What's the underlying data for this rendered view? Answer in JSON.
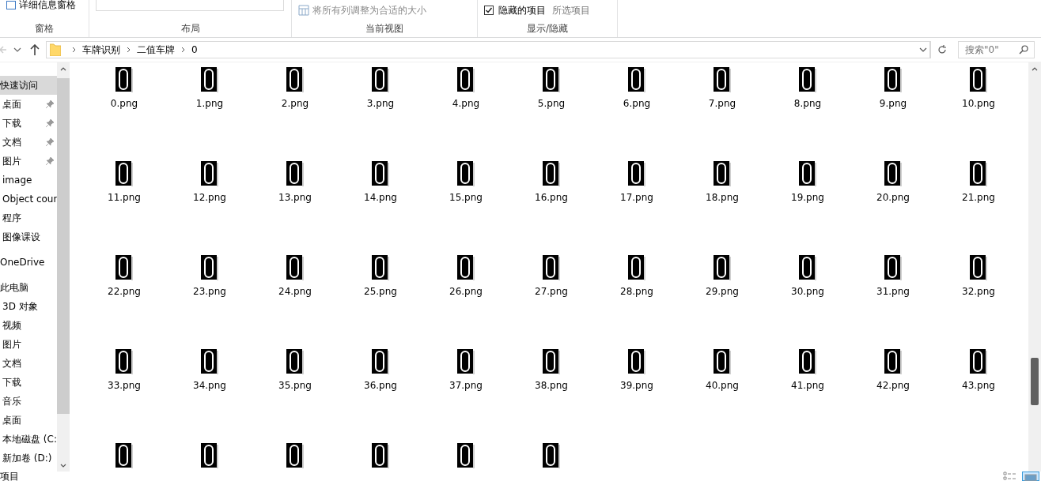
{
  "ribbon": {
    "groups": [
      {
        "label": "窗格",
        "items": [
          {
            "kind": "pane-button",
            "label": "详细信息窗格"
          }
        ]
      },
      {
        "label": "布局",
        "items": [
          {
            "kind": "layout-list"
          }
        ]
      },
      {
        "label": "当前视图",
        "items": [
          {
            "kind": "fit-columns",
            "label": "将所有列调整为合适的大小"
          }
        ]
      },
      {
        "label": "显示/隐藏",
        "items": [
          {
            "kind": "checkbox",
            "label": "隐藏的项目",
            "checked": true
          },
          {
            "kind": "text-button",
            "label": "所选项目"
          }
        ]
      }
    ]
  },
  "address": {
    "crumbs": [
      "车牌识别",
      "二值车牌",
      "0"
    ],
    "search_placeholder": "搜索\"0\""
  },
  "sidebar": {
    "items": [
      {
        "kind": "header",
        "label": "快速访问",
        "selected": true
      },
      {
        "kind": "pinned",
        "label": "桌面",
        "selected": false
      },
      {
        "kind": "pinned",
        "label": "下载",
        "selected": false
      },
      {
        "kind": "pinned",
        "label": "文档",
        "selected": false
      },
      {
        "kind": "pinned",
        "label": "图片",
        "selected": false
      },
      {
        "kind": "item",
        "label": "image",
        "selected": false
      },
      {
        "kind": "item",
        "label": "Object cour",
        "selected": false
      },
      {
        "kind": "item",
        "label": "程序",
        "selected": false
      },
      {
        "kind": "item",
        "label": "图像课设",
        "selected": false
      },
      {
        "kind": "header",
        "label": "OneDrive",
        "selected": false
      },
      {
        "kind": "header",
        "label": "此电脑",
        "selected": false
      },
      {
        "kind": "item",
        "label": "3D 对象",
        "selected": false
      },
      {
        "kind": "item",
        "label": "视频",
        "selected": false
      },
      {
        "kind": "item",
        "label": "图片",
        "selected": false
      },
      {
        "kind": "item",
        "label": "文档",
        "selected": false
      },
      {
        "kind": "item",
        "label": "下载",
        "selected": false
      },
      {
        "kind": "item",
        "label": "音乐",
        "selected": false
      },
      {
        "kind": "item",
        "label": "桌面",
        "selected": false
      },
      {
        "kind": "item",
        "label": "本地磁盘 (C:",
        "selected": false
      },
      {
        "kind": "item",
        "label": "新加卷 (D:)",
        "selected": false
      }
    ]
  },
  "files": [
    {
      "kind": "file",
      "label": "0.png"
    },
    {
      "kind": "file",
      "label": "1.png"
    },
    {
      "kind": "file",
      "label": "2.png"
    },
    {
      "kind": "file",
      "label": "3.png"
    },
    {
      "kind": "file",
      "label": "4.png"
    },
    {
      "kind": "file",
      "label": "5.png"
    },
    {
      "kind": "file",
      "label": "6.png"
    },
    {
      "kind": "file",
      "label": "7.png"
    },
    {
      "kind": "file",
      "label": "8.png"
    },
    {
      "kind": "file",
      "label": "9.png"
    },
    {
      "kind": "file",
      "label": "10.png"
    },
    {
      "kind": "file",
      "label": "11.png"
    },
    {
      "kind": "file",
      "label": "12.png"
    },
    {
      "kind": "file",
      "label": "13.png"
    },
    {
      "kind": "file",
      "label": "14.png"
    },
    {
      "kind": "file",
      "label": "15.png"
    },
    {
      "kind": "file",
      "label": "16.png"
    },
    {
      "kind": "file",
      "label": "17.png"
    },
    {
      "kind": "file",
      "label": "18.png"
    },
    {
      "kind": "file",
      "label": "19.png"
    },
    {
      "kind": "file",
      "label": "20.png"
    },
    {
      "kind": "file",
      "label": "21.png"
    },
    {
      "kind": "file",
      "label": "22.png"
    },
    {
      "kind": "file",
      "label": "23.png"
    },
    {
      "kind": "file",
      "label": "24.png"
    },
    {
      "kind": "file",
      "label": "25.png"
    },
    {
      "kind": "file",
      "label": "26.png"
    },
    {
      "kind": "file",
      "label": "27.png"
    },
    {
      "kind": "file",
      "label": "28.png"
    },
    {
      "kind": "file",
      "label": "29.png"
    },
    {
      "kind": "file",
      "label": "30.png"
    },
    {
      "kind": "file",
      "label": "31.png"
    },
    {
      "kind": "file",
      "label": "32.png"
    },
    {
      "kind": "file",
      "label": "33.png"
    },
    {
      "kind": "file",
      "label": "34.png"
    },
    {
      "kind": "file",
      "label": "35.png"
    },
    {
      "kind": "file",
      "label": "36.png"
    },
    {
      "kind": "file",
      "label": "37.png"
    },
    {
      "kind": "file",
      "label": "38.png"
    },
    {
      "kind": "file",
      "label": "39.png"
    },
    {
      "kind": "file",
      "label": "40.png"
    },
    {
      "kind": "file",
      "label": "41.png"
    },
    {
      "kind": "file",
      "label": "42.png"
    },
    {
      "kind": "file",
      "label": "43.png"
    },
    {
      "kind": "file-cut"
    },
    {
      "kind": "file-cut"
    },
    {
      "kind": "file-cut"
    },
    {
      "kind": "file-cut"
    },
    {
      "kind": "file-cut"
    },
    {
      "kind": "file-cut"
    }
  ],
  "status_bar": {
    "text": "项目"
  }
}
